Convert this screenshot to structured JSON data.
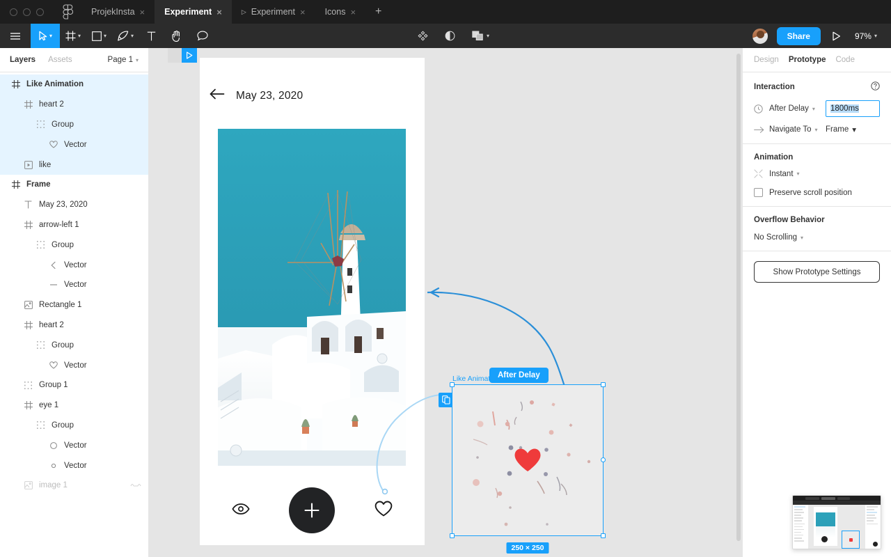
{
  "window": {
    "tabs": [
      {
        "label": "ProjekInsta",
        "active": false,
        "has_play_icon": false,
        "closable": true
      },
      {
        "label": "Experiment",
        "active": true,
        "has_play_icon": false,
        "closable": true
      },
      {
        "label": "Experiment",
        "active": false,
        "has_play_icon": true,
        "closable": true
      },
      {
        "label": "Icons",
        "active": false,
        "has_play_icon": false,
        "closable": true
      }
    ],
    "new_tab_label": "+",
    "logo_name": "figma-logo"
  },
  "toolbar": {
    "left_tools": [
      {
        "name": "menu-icon",
        "label": "",
        "selected": false,
        "has_caret": false
      },
      {
        "name": "move-tool-icon",
        "label": "",
        "selected": true,
        "has_caret": true
      },
      {
        "name": "frame-tool-icon",
        "label": "",
        "selected": false,
        "has_caret": true
      },
      {
        "name": "shape-tool-icon",
        "label": "",
        "selected": false,
        "has_caret": true
      },
      {
        "name": "pen-tool-icon",
        "label": "",
        "selected": false,
        "has_caret": true
      },
      {
        "name": "text-tool-icon",
        "label": "",
        "selected": false,
        "has_caret": false
      },
      {
        "name": "hand-tool-icon",
        "label": "",
        "selected": false,
        "has_caret": false
      },
      {
        "name": "comment-tool-icon",
        "label": "",
        "selected": false,
        "has_caret": false
      }
    ],
    "center_tools": [
      {
        "name": "components-icon",
        "has_caret": false
      },
      {
        "name": "mask-icon",
        "has_caret": false
      },
      {
        "name": "boolean-union-icon",
        "has_caret": true
      }
    ],
    "share_label": "Share",
    "present_icon": "play-icon",
    "zoom_level": "97%",
    "avatar_name": "user-avatar"
  },
  "left_panel": {
    "tabs": [
      {
        "label": "Layers",
        "active": true
      },
      {
        "label": "Assets",
        "active": false
      }
    ],
    "page_selector": "Page 1",
    "layers": [
      {
        "label": "Like Animation",
        "icon": "component-icon",
        "indent": 0,
        "selected": true,
        "bold": true,
        "dim": false
      },
      {
        "label": "heart 2",
        "icon": "component-icon",
        "indent": 1,
        "selected": true,
        "bold": false,
        "dim": false
      },
      {
        "label": "Group",
        "icon": "group-icon",
        "indent": 2,
        "selected": true,
        "bold": false,
        "dim": false
      },
      {
        "label": "Vector",
        "icon": "heart-icon",
        "indent": 3,
        "selected": true,
        "bold": false,
        "dim": false
      },
      {
        "label": "like",
        "icon": "frame-play-icon",
        "indent": 1,
        "selected": true,
        "bold": false,
        "dim": false
      },
      {
        "label": "Frame",
        "icon": "component-icon",
        "indent": 0,
        "selected": false,
        "bold": true,
        "dim": false
      },
      {
        "label": "May 23, 2020",
        "icon": "text-icon",
        "indent": 1,
        "selected": false,
        "bold": false,
        "dim": false
      },
      {
        "label": "arrow-left 1",
        "icon": "component-icon",
        "indent": 1,
        "selected": false,
        "bold": false,
        "dim": false
      },
      {
        "label": "Group",
        "icon": "group-icon",
        "indent": 2,
        "selected": false,
        "bold": false,
        "dim": false
      },
      {
        "label": "Vector",
        "icon": "chevron-left-icon",
        "indent": 3,
        "selected": false,
        "bold": false,
        "dim": false
      },
      {
        "label": "Vector",
        "icon": "line-icon",
        "indent": 3,
        "selected": false,
        "bold": false,
        "dim": false
      },
      {
        "label": "Rectangle 1",
        "icon": "image-icon",
        "indent": 1,
        "selected": false,
        "bold": false,
        "dim": false
      },
      {
        "label": "heart 2",
        "icon": "component-icon",
        "indent": 1,
        "selected": false,
        "bold": false,
        "dim": false
      },
      {
        "label": "Group",
        "icon": "group-icon",
        "indent": 2,
        "selected": false,
        "bold": false,
        "dim": false
      },
      {
        "label": "Vector",
        "icon": "heart-icon",
        "indent": 3,
        "selected": false,
        "bold": false,
        "dim": false
      },
      {
        "label": "Group 1",
        "icon": "group-icon",
        "indent": 1,
        "selected": false,
        "bold": false,
        "dim": false
      },
      {
        "label": "eye 1",
        "icon": "component-icon",
        "indent": 1,
        "selected": false,
        "bold": false,
        "dim": false
      },
      {
        "label": "Group",
        "icon": "group-icon",
        "indent": 2,
        "selected": false,
        "bold": false,
        "dim": false
      },
      {
        "label": "Vector",
        "icon": "circle-icon",
        "indent": 3,
        "selected": false,
        "bold": false,
        "dim": false
      },
      {
        "label": "Vector",
        "icon": "dot-icon",
        "indent": 3,
        "selected": false,
        "bold": false,
        "dim": false
      },
      {
        "label": "image 1",
        "icon": "image-icon",
        "indent": 1,
        "selected": false,
        "bold": false,
        "dim": true,
        "spark": true
      }
    ]
  },
  "canvas": {
    "phone": {
      "frame_label": "",
      "date_title": "May 23, 2020",
      "back_icon": "arrow-left-icon",
      "bottom_icons": [
        {
          "name": "eye-icon"
        },
        {
          "name": "plus-button"
        },
        {
          "name": "heart-icon"
        }
      ]
    },
    "selected_frame": {
      "label": "Like Animation",
      "size_badge": "250 × 250",
      "content_icon": "red-heart-confetti"
    },
    "interaction_tooltip": "After Delay",
    "connector_name": "prototype-connector-arrow",
    "flow_start_badge": "flow-start-icon"
  },
  "right_panel": {
    "tabs": [
      {
        "label": "Design",
        "active": false
      },
      {
        "label": "Prototype",
        "active": true
      },
      {
        "label": "Code",
        "active": false
      }
    ],
    "interaction": {
      "title": "Interaction",
      "help_icon": "help-icon",
      "trigger_label": "After Delay",
      "trigger_icon": "clock-icon",
      "delay_value": "1800ms",
      "action_label": "Navigate To",
      "action_icon": "arrow-right-icon",
      "destination": "Frame"
    },
    "animation": {
      "title": "Animation",
      "type": "Instant",
      "type_icon": "instant-icon",
      "preserve_scroll_label": "Preserve scroll position",
      "preserve_scroll_checked": false
    },
    "overflow": {
      "title": "Overflow Behavior",
      "value": "No Scrolling"
    },
    "show_settings_label": "Show Prototype Settings"
  },
  "colors": {
    "accent": "#18a0fb",
    "toolbar_bg": "#2c2c2c",
    "tabbar_bg": "#1e1e1e",
    "canvas_bg": "#e5e5e5",
    "panel_bg": "#ffffff",
    "heart_red": "#ef3b3b",
    "photo_sky": "#2b9fb8",
    "selection_row": "#e5f4ff"
  },
  "minimap": {
    "name": "minimap-thumbnail"
  }
}
